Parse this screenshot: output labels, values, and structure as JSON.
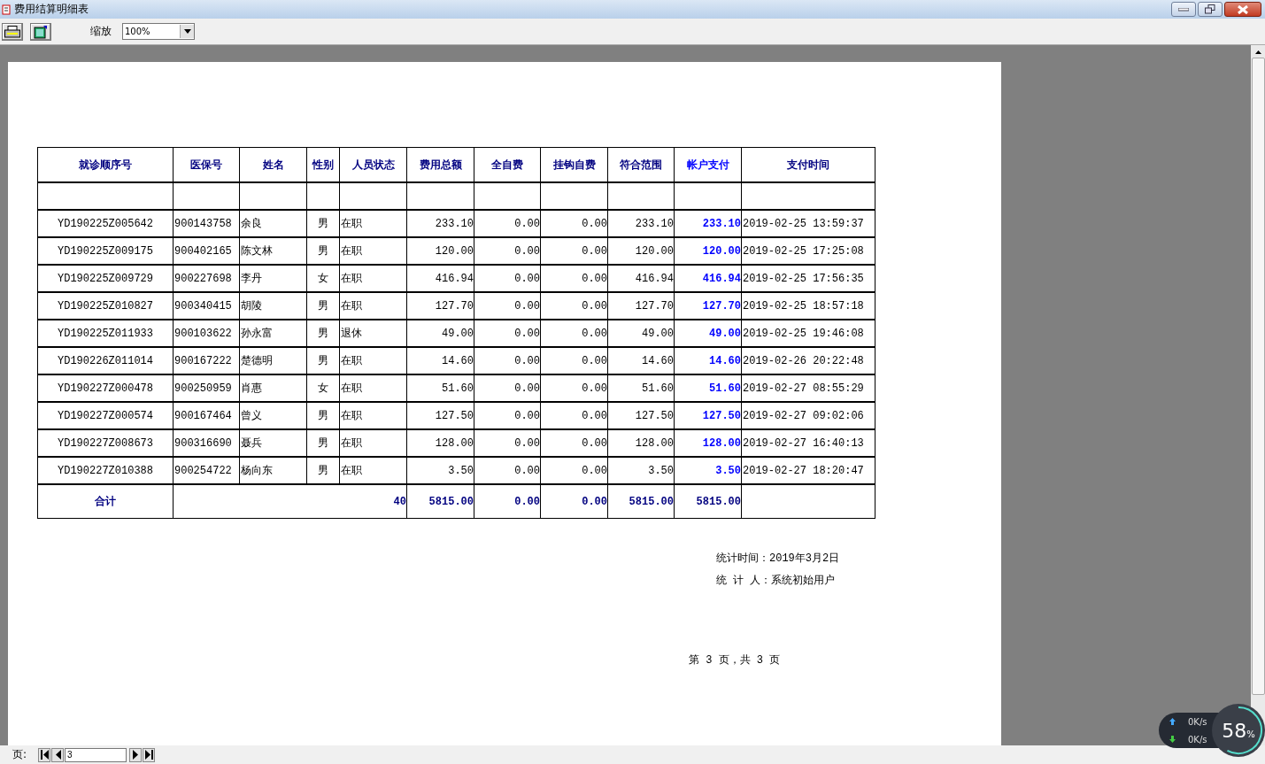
{
  "window": {
    "title": "费用结算明细表"
  },
  "toolbar": {
    "zoom_label": "缩放",
    "zoom_value": "100%"
  },
  "table": {
    "columns": [
      {
        "label": "就诊顺序号",
        "kind": "plain"
      },
      {
        "label": "医保号",
        "kind": "plain"
      },
      {
        "label": "姓名",
        "kind": "plain"
      },
      {
        "label": "性别",
        "kind": "plain"
      },
      {
        "label": "人员状态",
        "kind": "plain"
      },
      {
        "label": "费用总额",
        "kind": "plain"
      },
      {
        "label": "全自费",
        "kind": "plain"
      },
      {
        "label": "挂钩自费",
        "kind": "plain"
      },
      {
        "label": "符合范围",
        "kind": "plain"
      },
      {
        "label": "帐户支付",
        "kind": "accent"
      },
      {
        "label": "支付时间",
        "kind": "plain"
      }
    ],
    "rows": [
      [
        "YD190225Z005642",
        "900143758",
        "余良",
        "男",
        "在职",
        "233.10",
        "0.00",
        "0.00",
        "233.10",
        "233.10",
        "2019-02-25 13:59:37"
      ],
      [
        "YD190225Z009175",
        "900402165",
        "陈文林",
        "男",
        "在职",
        "120.00",
        "0.00",
        "0.00",
        "120.00",
        "120.00",
        "2019-02-25 17:25:08"
      ],
      [
        "YD190225Z009729",
        "900227698",
        "李丹",
        "女",
        "在职",
        "416.94",
        "0.00",
        "0.00",
        "416.94",
        "416.94",
        "2019-02-25 17:56:35"
      ],
      [
        "YD190225Z010827",
        "900340415",
        "胡陵",
        "男",
        "在职",
        "127.70",
        "0.00",
        "0.00",
        "127.70",
        "127.70",
        "2019-02-25 18:57:18"
      ],
      [
        "YD190225Z011933",
        "900103622",
        "孙永富",
        "男",
        "退休",
        "49.00",
        "0.00",
        "0.00",
        "49.00",
        "49.00",
        "2019-02-25 19:46:08"
      ],
      [
        "YD190226Z011014",
        "900167222",
        "楚德明",
        "男",
        "在职",
        "14.60",
        "0.00",
        "0.00",
        "14.60",
        "14.60",
        "2019-02-26 20:22:48"
      ],
      [
        "YD190227Z000478",
        "900250959",
        "肖惠",
        "女",
        "在职",
        "51.60",
        "0.00",
        "0.00",
        "51.60",
        "51.60",
        "2019-02-27 08:55:29"
      ],
      [
        "YD190227Z000574",
        "900167464",
        "曾义",
        "男",
        "在职",
        "127.50",
        "0.00",
        "0.00",
        "127.50",
        "127.50",
        "2019-02-27 09:02:06"
      ],
      [
        "YD190227Z008673",
        "900316690",
        "聂兵",
        "男",
        "在职",
        "128.00",
        "0.00",
        "0.00",
        "128.00",
        "128.00",
        "2019-02-27 16:40:13"
      ],
      [
        "YD190227Z010388",
        "900254722",
        "杨向东",
        "男",
        "在职",
        "3.50",
        "0.00",
        "0.00",
        "3.50",
        "3.50",
        "2019-02-27 18:20:47"
      ]
    ],
    "total": {
      "label": "合计",
      "count": "40",
      "values": [
        "5815.00",
        "0.00",
        "0.00",
        "5815.00",
        "5815.00"
      ]
    }
  },
  "footer": {
    "stat_time": "统计时间：2019年3月2日",
    "stat_person": "统 计 人：系统初始用户",
    "page_info": "第 3 页，共 3 页"
  },
  "pager": {
    "label": "页:",
    "page": "3"
  },
  "net_widget": {
    "upload": "0K/s",
    "download": "0K/s",
    "percent": "58",
    "unit": "%"
  }
}
